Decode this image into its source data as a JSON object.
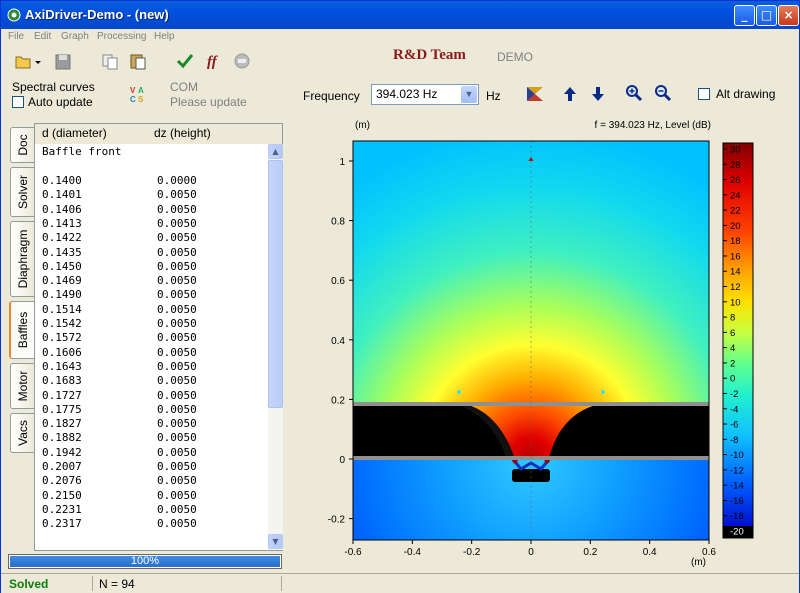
{
  "window": {
    "title": "AxiDriver-Demo - (new)"
  },
  "menu": [
    "File",
    "Edit",
    "Graph",
    "Processing",
    "Help"
  ],
  "header": {
    "team": "R&D Team",
    "demo": "DEMO"
  },
  "left_controls": {
    "spectral": "Spectral curves",
    "auto_update": "Auto update",
    "com": "COM",
    "please_update": "Please update"
  },
  "frequency": {
    "label": "Frequency",
    "value": "394.023 Hz",
    "unit": "Hz"
  },
  "alt_drawing": "Alt drawing",
  "tabs": [
    "Doc",
    "Solver",
    "Diaphragm",
    "Baffles",
    "Motor",
    "Vacs"
  ],
  "active_tab": "Baffles",
  "table": {
    "col1": "d (diameter)",
    "col2": "dz (height)",
    "section": "Baffle front",
    "rows": [
      [
        "0.1400",
        "0.0000"
      ],
      [
        "0.1401",
        "0.0050"
      ],
      [
        "0.1406",
        "0.0050"
      ],
      [
        "0.1413",
        "0.0050"
      ],
      [
        "0.1422",
        "0.0050"
      ],
      [
        "0.1435",
        "0.0050"
      ],
      [
        "0.1450",
        "0.0050"
      ],
      [
        "0.1469",
        "0.0050"
      ],
      [
        "0.1490",
        "0.0050"
      ],
      [
        "0.1514",
        "0.0050"
      ],
      [
        "0.1542",
        "0.0050"
      ],
      [
        "0.1572",
        "0.0050"
      ],
      [
        "0.1606",
        "0.0050"
      ],
      [
        "0.1643",
        "0.0050"
      ],
      [
        "0.1683",
        "0.0050"
      ],
      [
        "0.1727",
        "0.0050"
      ],
      [
        "0.1775",
        "0.0050"
      ],
      [
        "0.1827",
        "0.0050"
      ],
      [
        "0.1882",
        "0.0050"
      ],
      [
        "0.1942",
        "0.0050"
      ],
      [
        "0.2007",
        "0.0050"
      ],
      [
        "0.2076",
        "0.0050"
      ],
      [
        "0.2150",
        "0.0050"
      ],
      [
        "0.2231",
        "0.0050"
      ],
      [
        "0.2317",
        "0.0050"
      ]
    ]
  },
  "progress": {
    "label": "100%",
    "value": 1.0
  },
  "status": {
    "state": "Solved",
    "n": "N = 94"
  },
  "plot": {
    "y_unit": "(m)",
    "x_unit": "(m)",
    "caption": "f = 394.023 Hz, Level  (dB)",
    "x_ticks": [
      "-0.6",
      "-0.4",
      "-0.2",
      "0",
      "0.2",
      "0.4",
      "0.6"
    ],
    "y_ticks": [
      "1",
      "0.8",
      "0.6",
      "0.4",
      "0.2",
      "0",
      "-0.2"
    ],
    "colorbar_ticks": [
      "30",
      "28",
      "26",
      "24",
      "22",
      "20",
      "18",
      "16",
      "14",
      "12",
      "10",
      "8",
      "6",
      "4",
      "2",
      "0",
      "-2",
      "-4",
      "-6",
      "-8",
      "-10",
      "-12",
      "-14",
      "-16",
      "-18",
      "-20"
    ],
    "level_range_db": [
      -20,
      30
    ]
  },
  "colors": {
    "accent": "#0054e3",
    "solved": "#0b7d0b",
    "team": "#8b1a1a"
  }
}
